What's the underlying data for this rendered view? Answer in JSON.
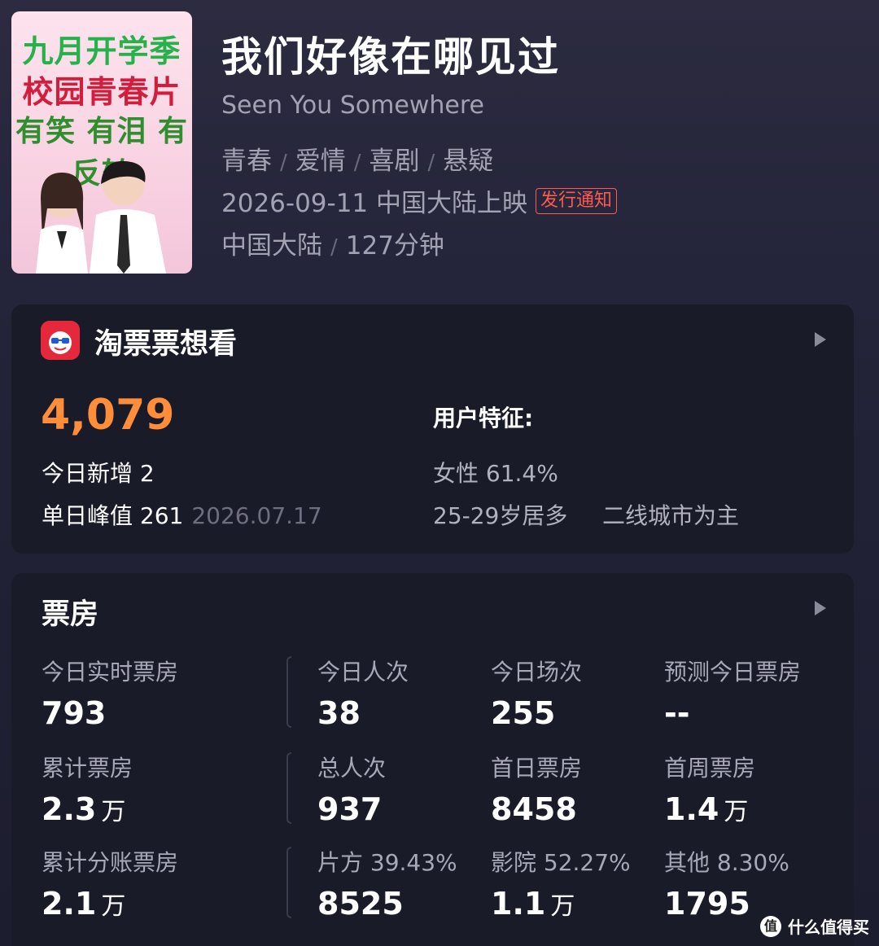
{
  "poster": {
    "line1": "九月开学季",
    "line2": "校园青春片",
    "line3": "有笑 有泪 有反转"
  },
  "movie": {
    "title": "我们好像在哪见过",
    "subtitle": "Seen You Somewhere",
    "genres": [
      "青春",
      "爱情",
      "喜剧",
      "悬疑"
    ],
    "release": "2026-09-11 中国大陆上映",
    "release_badge": "发行通知",
    "region": "中国大陆",
    "duration": "127分钟"
  },
  "want": {
    "title": "淘票票想看",
    "count": "4,079",
    "today_new": "今日新增 2",
    "peak": "单日峰值 261",
    "peak_date": "2026.07.17",
    "user_title": "用户特征:",
    "gender": "女性 61.4%",
    "age": "25-29岁居多",
    "city": "二线城市为主"
  },
  "boxoffice": {
    "title": "票房",
    "rows": [
      [
        {
          "label": "今日实时票房",
          "value": "793",
          "unit": ""
        },
        {
          "label": "今日人次",
          "value": "38",
          "unit": ""
        },
        {
          "label": "今日场次",
          "value": "255",
          "unit": ""
        },
        {
          "label": "预测今日票房",
          "value": "--",
          "unit": ""
        }
      ],
      [
        {
          "label": "累计票房",
          "value": "2.3",
          "unit": "万"
        },
        {
          "label": "总人次",
          "value": "937",
          "unit": ""
        },
        {
          "label": "首日票房",
          "value": "8458",
          "unit": ""
        },
        {
          "label": "首周票房",
          "value": "1.4",
          "unit": "万"
        }
      ],
      [
        {
          "label": "累计分账票房",
          "value": "2.1",
          "unit": "万"
        },
        {
          "label": "片方 39.43%",
          "value": "8525",
          "unit": ""
        },
        {
          "label": "影院 52.27%",
          "value": "1.1",
          "unit": "万"
        },
        {
          "label": "其他 8.30%",
          "value": "1795",
          "unit": ""
        }
      ]
    ]
  },
  "watermark": {
    "icon": "值",
    "text": "什么值得买"
  }
}
